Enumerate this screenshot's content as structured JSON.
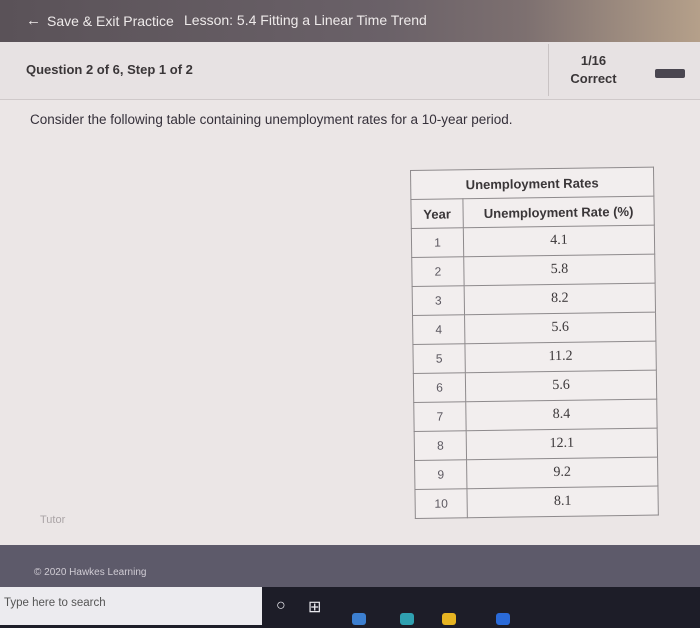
{
  "topbar": {
    "back_label": "Save & Exit Practice",
    "lesson_title": "Lesson: 5.4 Fitting a Linear Time Trend"
  },
  "question": {
    "title": "Question 2 of 6, Step 1 of 2",
    "score": "1/16",
    "status": "Correct",
    "prompt": "Consider the following table containing unemployment rates for a 10-year period."
  },
  "table": {
    "caption": "Unemployment Rates",
    "headers": [
      "Year",
      "Unemployment Rate (%)"
    ],
    "rows": [
      [
        "1",
        "4.1"
      ],
      [
        "2",
        "5.8"
      ],
      [
        "3",
        "8.2"
      ],
      [
        "4",
        "5.6"
      ],
      [
        "5",
        "11.2"
      ],
      [
        "6",
        "5.6"
      ],
      [
        "7",
        "8.4"
      ],
      [
        "8",
        "12.1"
      ],
      [
        "9",
        "9.2"
      ],
      [
        "10",
        "8.1"
      ]
    ]
  },
  "tutor_label": "Tutor",
  "footer": {
    "copyright": "© 2020 Hawkes Learning"
  },
  "taskbar": {
    "search_placeholder": "Type here to search",
    "icons": [
      "cortana-circle-icon",
      "task-view-icon"
    ]
  },
  "colors": {
    "topbar": "#5a5258",
    "footer": "#5d5a6a",
    "taskbar": "#1d1d28"
  }
}
